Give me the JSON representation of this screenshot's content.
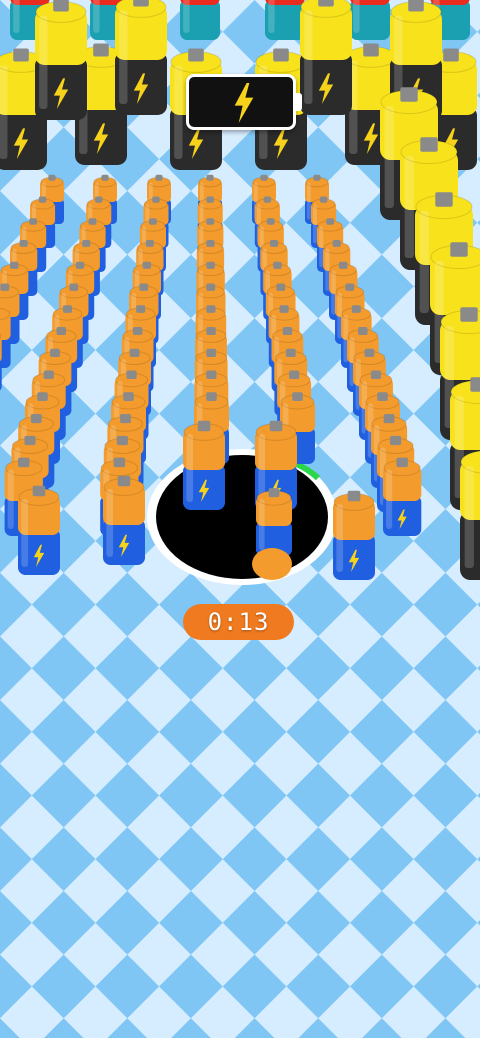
{
  "hud": {
    "charge_icon": "lightning-bolt-icon",
    "timer": "0:13"
  },
  "colors": {
    "floor_light": "#d6ecff",
    "floor_dark": "#7fc6f5",
    "hole": "#000000",
    "hole_rim": "#ffffff",
    "progress_ring": "#2ad64a",
    "orange_battery_cap": "#f39b2c",
    "orange_battery_body": "#1f5fe0",
    "large_battery_cap": "#f7e21b",
    "large_battery_body": "#2b2b2b",
    "red_battery_cap": "#ea2b1f",
    "timer_bg": "#f07a1f"
  }
}
